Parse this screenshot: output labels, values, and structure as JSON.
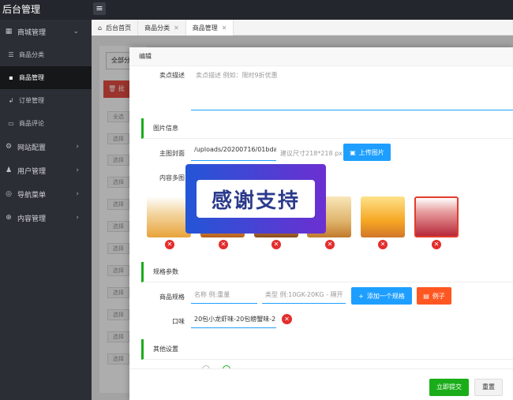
{
  "app": {
    "title": "后台管理"
  },
  "sidebar": {
    "groups": [
      {
        "label": "商城管理",
        "icon": "grid-icon",
        "arrow": "⌄"
      },
      {
        "label": "网站配置",
        "icon": "gear-icon",
        "arrow": "›"
      },
      {
        "label": "用户管理",
        "icon": "user-icon",
        "arrow": "›"
      },
      {
        "label": "导航菜单",
        "icon": "compass-icon",
        "arrow": "›"
      },
      {
        "label": "内容管理",
        "icon": "globe-icon",
        "arrow": "›"
      }
    ],
    "items": [
      {
        "label": "商品分类",
        "icon": "list-icon"
      },
      {
        "label": "商品管理",
        "icon": "box-icon",
        "active": true
      },
      {
        "label": "订单管理",
        "icon": "order-icon"
      },
      {
        "label": "商品评论",
        "icon": "comment-icon"
      }
    ]
  },
  "tabs": [
    {
      "label": "后台首页",
      "icon": "home-icon",
      "closable": false
    },
    {
      "label": "商品分类",
      "closable": true
    },
    {
      "label": "商品管理",
      "closable": true,
      "active": true
    }
  ],
  "background": {
    "filter_label": "全部分",
    "batch_label": "批",
    "row_button": "选择",
    "header_cell": "全选"
  },
  "modal": {
    "title": "编辑",
    "selling_point": {
      "label": "卖点描述",
      "placeholder": "卖点描述 例如：限时9折优惠"
    },
    "image_section": {
      "title": "图片信息",
      "cover_label": "主图封面",
      "cover_value": "/uploads/20200716/01bda",
      "cover_hint": "建议尺寸218*218 px",
      "upload_button": "上传图片",
      "gallery_label": "内容多图"
    },
    "banner_text": "感谢支持",
    "spec_section": {
      "title": "规格参数",
      "spec_label": "商品规格",
      "name_placeholder": "名称 例:重量",
      "type_placeholder": "类型 例:10GK-20KG - 隔开",
      "add_button": "添加一个规格",
      "example_button": "例子",
      "flavor_label": "口味",
      "flavor_value": "20包小龙虾味-20包螃蟹味-2"
    },
    "other_section": {
      "title": "其他设置"
    },
    "footer": {
      "submit": "立即提交",
      "reset": "重置"
    }
  },
  "thumbnail_colors": [
    "#c0392b",
    "#d4a017",
    "#a0522d",
    "#e67e22",
    "#f1c40f",
    "#c0392b"
  ]
}
